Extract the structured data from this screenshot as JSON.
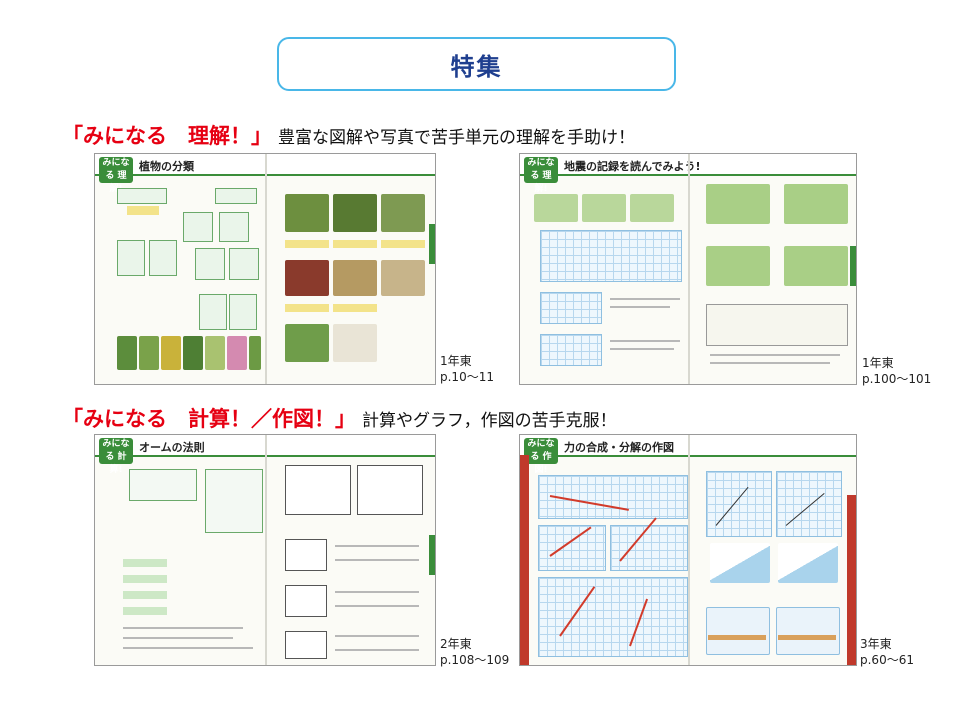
{
  "title": "特集",
  "section1": {
    "heading": "「みになる　理解！」",
    "description": "豊富な図解や写真で苦手単元の理解を手助け！"
  },
  "section2": {
    "heading": "「みになる　計算！／作図！」",
    "description": "計算やグラフ，作図の苦手克服！"
  },
  "thumbnails": [
    {
      "badge": "みになる 理解!",
      "page_title": "植物の分類",
      "grade": "1年東",
      "pages": "p.10〜11"
    },
    {
      "badge": "みになる 理解!",
      "page_title": "地震の記録を読んでみよう!",
      "grade": "1年東",
      "pages": "p.100〜101"
    },
    {
      "badge": "みになる 計算!",
      "page_title": "オームの法則",
      "grade": "2年東",
      "pages": "p.108〜109"
    },
    {
      "badge": "みになる 作図!",
      "page_title": "力の合成・分解の作図",
      "grade": "3年東",
      "pages": "p.60〜61"
    }
  ],
  "colors": {
    "accent_red": "#e60012",
    "title_border": "#49b7e8",
    "title_text": "#1f3f8f",
    "badge_green": "#3a8d3a"
  }
}
